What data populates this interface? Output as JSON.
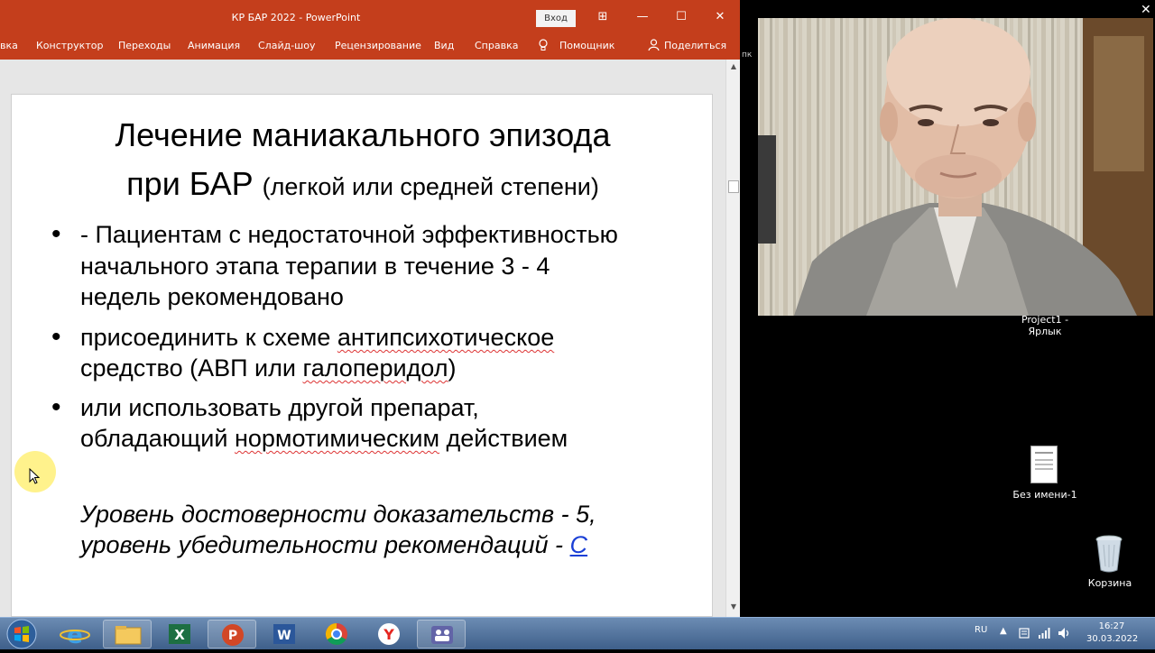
{
  "window": {
    "title": "КР БАР 2022  -  PowerPoint",
    "signin_label": "Вход",
    "minimize": "—",
    "restore": "☐",
    "close": "✕",
    "ribbon_mode": "⊞"
  },
  "ribbon": {
    "tabs": [
      "вка",
      "Конструктор",
      "Переходы",
      "Анимация",
      "Слайд-шоу",
      "Рецензирование",
      "Вид",
      "Справка",
      "Помощник",
      "Поделиться"
    ]
  },
  "slide": {
    "title_line1": "Лечение маниакального эпизода",
    "title_line2_main": "при БАР ",
    "title_line2_sub": "(легкой или средней степени)",
    "bullet_glyph": "•",
    "b1_line1": "- Пациентам с недостаточной эффективностью",
    "b1_line2": "начального этапа терапии в течение 3 - 4",
    "b1_line3": "недель рекомендовано",
    "b2_line1_a": "присоединить к схеме ",
    "b2_line1_b": "антипсихотическое",
    "b2_line2_a": "средство (АВП или ",
    "b2_line2_b": "галоперидол",
    "b2_line2_c": ")",
    "b3_line1": "или использовать другой препарат,",
    "b3_line2_a": "обладающий ",
    "b3_line2_b": "нормотимическим",
    "b3_line2_c": " действием",
    "evidence_line1": "Уровень достоверности доказательств - 5,",
    "evidence_line2_a": "уровень убедительности рекомендаций - ",
    "evidence_line2_b": "С"
  },
  "video": {
    "close": "✕"
  },
  "desktop": {
    "partial_label": "пк",
    "icon1_label_1": "Project1 -",
    "icon1_label_2": "Ярлык",
    "icon2_label": "Без имени-1",
    "icon3_label": "Корзина"
  },
  "taskbar": {
    "apps": [
      "start",
      "internet-explorer",
      "file-explorer",
      "excel",
      "powerpoint",
      "word",
      "chrome",
      "yandex-browser",
      "teams"
    ],
    "excel_letter": "X",
    "powerpoint_letter": "P",
    "word_letter": "W",
    "yandex_letter": "Y",
    "lang": "RU",
    "time": "16:27",
    "date": "30.03.2022"
  },
  "colors": {
    "ppt_accent": "#c43e1c",
    "link_blue": "#1a3fd6",
    "spellcheck": "#d33"
  }
}
